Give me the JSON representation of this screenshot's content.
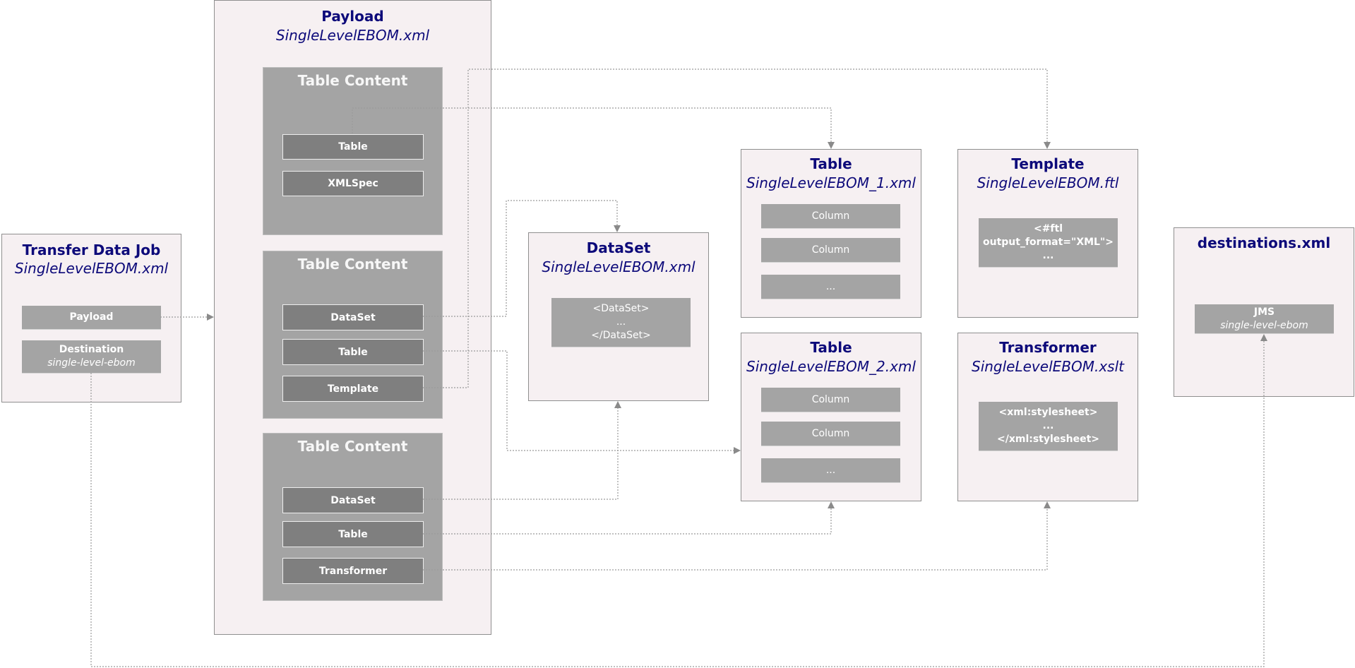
{
  "colors": {
    "title_text": "#0d0a7a",
    "box_fill": "#f6f0f2",
    "box_border": "#8f8f8f",
    "table_content_fill": "#a4a4a4",
    "button_fill": "#7f7f7f",
    "connector": "#8c8c8c"
  },
  "transfer_job": {
    "title": "Transfer Data Job",
    "subtitle": "SingleLevelEBOM.xml",
    "payload_label": "Payload",
    "destination_label": "Destination",
    "destination_value": "single-level-ebom"
  },
  "payload": {
    "title": "Payload",
    "subtitle": "SingleLevelEBOM.xml",
    "table_contents": [
      {
        "title": "Table Content",
        "items": [
          "Table",
          "XMLSpec"
        ]
      },
      {
        "title": "Table Content",
        "items": [
          "DataSet",
          "Table",
          "Template"
        ]
      },
      {
        "title": "Table Content",
        "items": [
          "DataSet",
          "Table",
          "Transformer"
        ]
      }
    ]
  },
  "dataset": {
    "title": "DataSet",
    "subtitle": "SingleLevelEBOM.xml",
    "content_lines": [
      "<DataSet>",
      "...",
      "</DataSet>"
    ]
  },
  "table1": {
    "title": "Table",
    "subtitle": "SingleLevelEBOM_1.xml",
    "rows": [
      "Column",
      "Column",
      "..."
    ]
  },
  "table2": {
    "title": "Table",
    "subtitle": "SingleLevelEBOM_2.xml",
    "rows": [
      "Column",
      "Column",
      "..."
    ]
  },
  "template": {
    "title": "Template",
    "subtitle": "SingleLevelEBOM.ftl",
    "content_lines": [
      "<#ftl",
      "output_format=\"XML\">",
      "..."
    ]
  },
  "transformer": {
    "title": "Transformer",
    "subtitle": "SingleLevelEBOM.xslt",
    "content_lines": [
      "<xml:stylesheet>",
      "...",
      "</xml:stylesheet>"
    ]
  },
  "destinations": {
    "title": "destinations.xml",
    "jms_label": "JMS",
    "jms_value": "single-level-ebom"
  }
}
